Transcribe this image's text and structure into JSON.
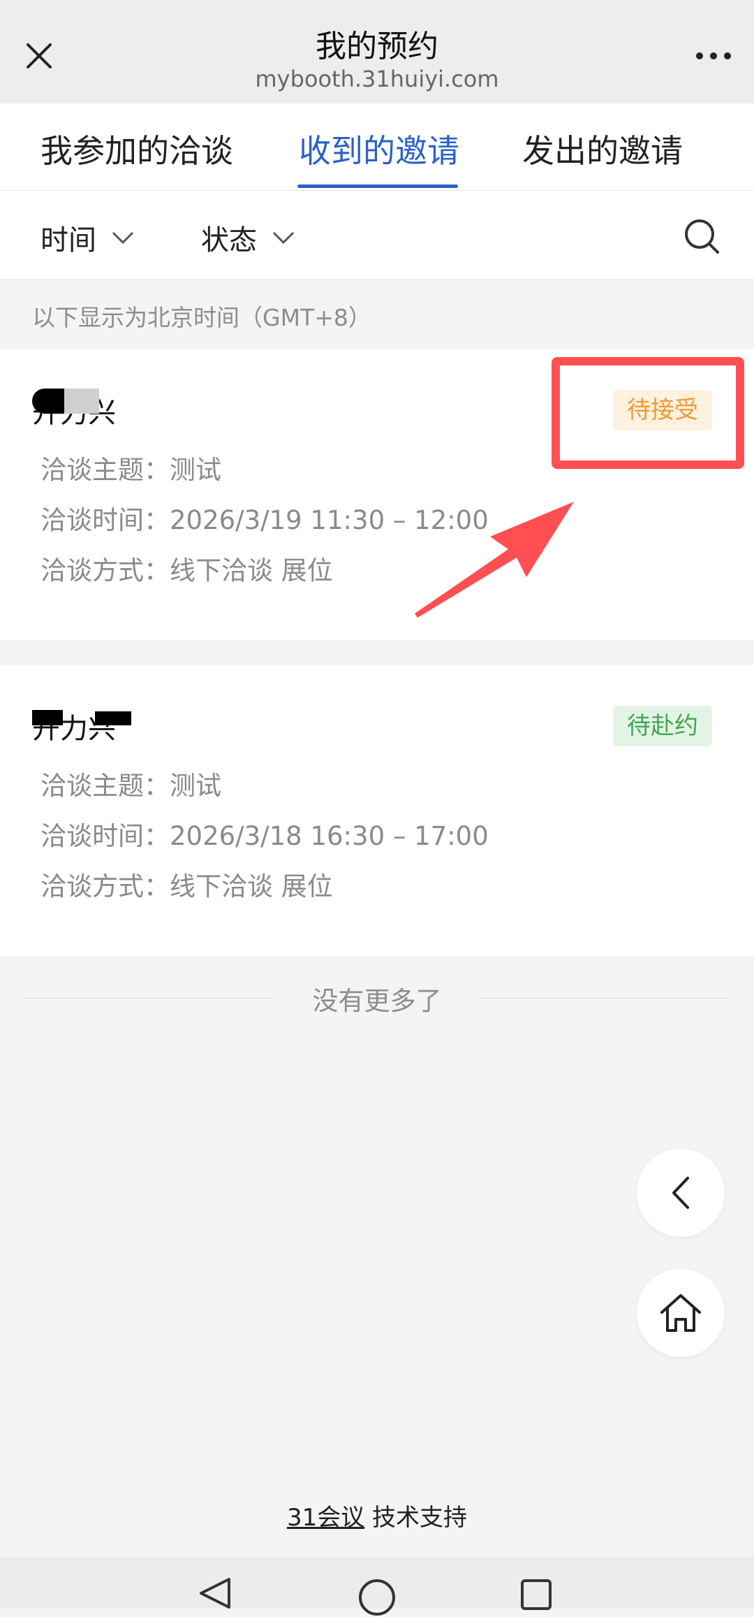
{
  "header": {
    "title": "我的预约",
    "subtitle": "mybooth.31huiyi.com"
  },
  "tabs": [
    {
      "label": "我参加的洽谈",
      "active": false
    },
    {
      "label": "收到的邀请",
      "active": true
    },
    {
      "label": "发出的邀请",
      "active": false
    }
  ],
  "filters": {
    "time_label": "时间",
    "status_label": "状态"
  },
  "timezone_note": "以下显示为北京时间（GMT+8）",
  "cards": [
    {
      "company": "开力兴",
      "status": "待接受",
      "topic_label": "洽谈主题：",
      "topic": "测试",
      "time_label": "洽谈时间：",
      "time": "2026/3/19 11:30 – 12:00",
      "mode_label": "洽谈方式：",
      "mode": "线下洽谈 展位"
    },
    {
      "company": "开力兴",
      "status": "待赴约",
      "topic_label": "洽谈主题：",
      "topic": "测试",
      "time_label": "洽谈时间：",
      "time": "2026/3/18 16:30 – 17:00",
      "mode_label": "洽谈方式：",
      "mode": "线下洽谈 展位"
    }
  ],
  "list_end": "没有更多了",
  "footer": {
    "brand": "31会议",
    "suffix": " 技术支持"
  },
  "colors": {
    "accent": "#2a62c9",
    "pending": "#f09a33",
    "upcoming": "#3fa74f",
    "annotation": "#ff4f52"
  },
  "icons": [
    "close-icon",
    "more-icon",
    "chevron-down-icon",
    "search-icon",
    "back-icon",
    "home-icon",
    "nav-back-icon",
    "nav-home-icon",
    "nav-recent-icon"
  ]
}
